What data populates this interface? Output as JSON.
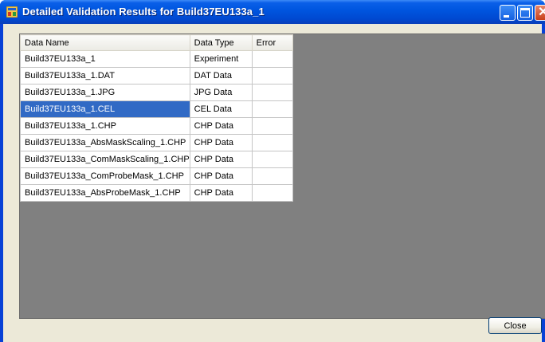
{
  "window": {
    "title": "Detailed Validation Results for Build37EU133a_1"
  },
  "table": {
    "columns": [
      "Data Name",
      "Data Type",
      "Error"
    ],
    "rows": [
      {
        "name": "Build37EU133a_1",
        "type": "Experiment",
        "error": ""
      },
      {
        "name": "Build37EU133a_1.DAT",
        "type": "DAT Data",
        "error": ""
      },
      {
        "name": "Build37EU133a_1.JPG",
        "type": "JPG Data",
        "error": ""
      },
      {
        "name": "Build37EU133a_1.CEL",
        "type": "CEL Data",
        "error": ""
      },
      {
        "name": "Build37EU133a_1.CHP",
        "type": "CHP Data",
        "error": ""
      },
      {
        "name": "Build37EU133a_AbsMaskScaling_1.CHP",
        "type": "CHP Data",
        "error": ""
      },
      {
        "name": "Build37EU133a_ComMaskScaling_1.CHP",
        "type": "CHP Data",
        "error": ""
      },
      {
        "name": "Build37EU133a_ComProbeMask_1.CHP",
        "type": "CHP Data",
        "error": ""
      },
      {
        "name": "Build37EU133a_AbsProbeMask_1.CHP",
        "type": "CHP Data",
        "error": ""
      }
    ],
    "selected_row": 3
  },
  "buttons": {
    "close_label": "Close"
  },
  "icons": {
    "app": "application-icon",
    "minimize": "minimize-icon",
    "maximize": "maximize-icon",
    "close": "close-icon"
  },
  "colors": {
    "titlebar": "#0054e3",
    "selection": "#316ac5",
    "grid_background": "#808080",
    "dialog_background": "#ece9d8"
  }
}
